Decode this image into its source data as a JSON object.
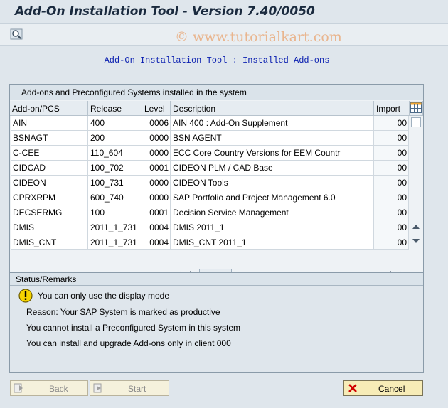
{
  "window": {
    "title": "Add-On Installation Tool - Version 7.40/0050"
  },
  "toolbar": {
    "watermark": "© www.tutorialkart.com",
    "find_icon": "magnifier-icon"
  },
  "subtitle": "Add-On Installation Tool : Installed Add-ons",
  "installed_group": {
    "title": "Add-ons and Preconfigured Systems installed in the system",
    "columns": [
      "Add-on/PCS",
      "Release",
      "Level",
      "Description",
      "Import ..."
    ],
    "rows": [
      {
        "addon": "AIN",
        "release": "400",
        "level": "0006",
        "description": "AIN 400 : Add-On Supplement",
        "import": "00"
      },
      {
        "addon": "BSNAGT",
        "release": "200",
        "level": "0000",
        "description": "BSN AGENT",
        "import": "00"
      },
      {
        "addon": "C-CEE",
        "release": "110_604",
        "level": "0000",
        "description": "ECC Core Country Versions for EEM Countr",
        "import": "00"
      },
      {
        "addon": "CIDCAD",
        "release": "100_702",
        "level": "0001",
        "description": "CIDEON PLM / CAD Base",
        "import": "00"
      },
      {
        "addon": "CIDEON",
        "release": "100_731",
        "level": "0000",
        "description": "CIDEON Tools",
        "import": "00"
      },
      {
        "addon": "CPRXRPM",
        "release": "600_740",
        "level": "0000",
        "description": "SAP Portfolio and Project Management 6.0",
        "import": "00"
      },
      {
        "addon": "DECSERMG",
        "release": "100",
        "level": "0001",
        "description": "Decision Service Management",
        "import": "00"
      },
      {
        "addon": "DMIS",
        "release": "2011_1_731",
        "level": "0004",
        "description": "DMIS 2011_1",
        "import": "00"
      },
      {
        "addon": "DMIS_CNT",
        "release": "2011_1_731",
        "level": "0004",
        "description": "DMIS_CNT 2011_1",
        "import": "00"
      }
    ]
  },
  "status": {
    "title": "Status/Remarks",
    "lines": [
      "You can only use the display mode",
      "Reason: Your SAP System is marked as productive",
      "You cannot install a Preconfigured System in this system",
      "You can install and upgrade Add-ons only in client 000"
    ]
  },
  "buttons": {
    "back": "Back",
    "start": "Start",
    "cancel": "Cancel"
  },
  "colors": {
    "subtitle": "#0a1fb0",
    "watermark": "#e9b58e",
    "cancel_bg": "#f7ecb7",
    "warning": "#f5d400"
  }
}
